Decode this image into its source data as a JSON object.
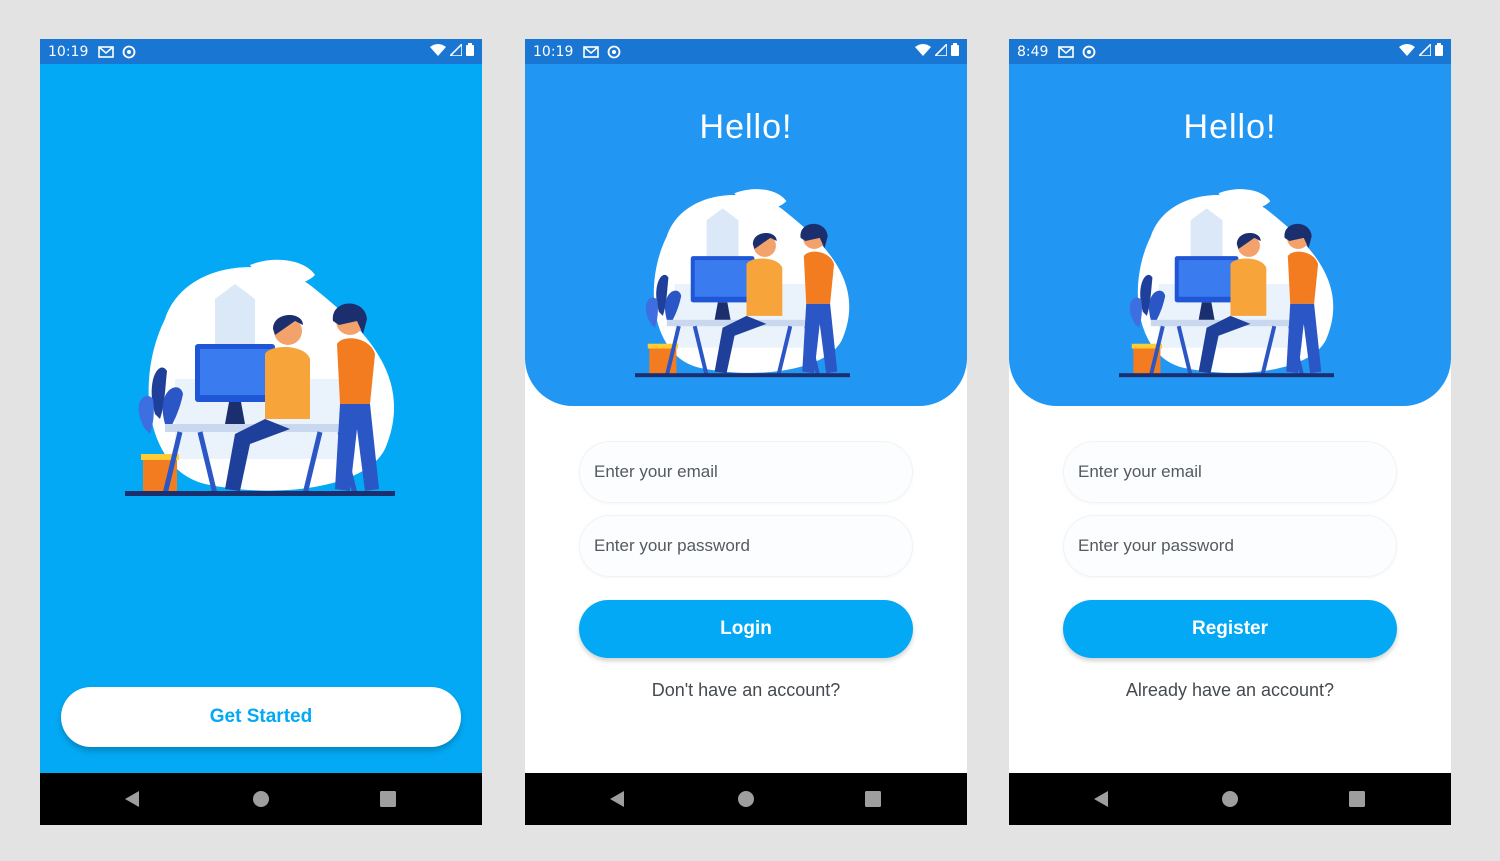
{
  "colors": {
    "primary": "#03a9f4",
    "header_blue": "#2196f3",
    "status_bar": "#1976d2",
    "nav_bar": "#000000"
  },
  "screens": [
    {
      "status": {
        "time": "10:19",
        "icons": [
          "gmail-icon",
          "sync-icon",
          "wifi-icon",
          "signal-icon",
          "battery-icon"
        ]
      },
      "illustration": "office-teamwork-illustration",
      "button_label": "Get Started"
    },
    {
      "status": {
        "time": "10:19",
        "icons": [
          "gmail-icon",
          "sync-icon",
          "wifi-icon",
          "signal-icon",
          "battery-icon"
        ]
      },
      "title": "Hello!",
      "illustration": "office-teamwork-illustration",
      "email_placeholder": "Enter your email",
      "password_placeholder": "Enter your password",
      "button_label": "Login",
      "link_text": "Don't have an account?"
    },
    {
      "status": {
        "time": "8:49",
        "icons": [
          "gmail-icon",
          "sync-icon",
          "wifi-icon",
          "signal-icon",
          "battery-icon"
        ]
      },
      "title": "Hello!",
      "illustration": "office-teamwork-illustration",
      "email_placeholder": "Enter your email",
      "password_placeholder": "Enter your password",
      "button_label": "Register",
      "link_text": "Already have an account?"
    }
  ],
  "nav": {
    "icons": [
      "back-icon",
      "home-icon",
      "recents-icon"
    ]
  }
}
